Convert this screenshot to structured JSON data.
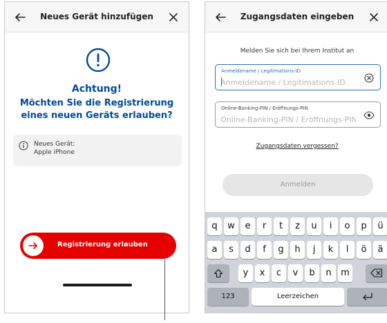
{
  "left_screen": {
    "title": "Neues Gerät hinzufügen",
    "heading": "Achtung!",
    "question": "Möchten Sie die Registrierung eines neuen Geräts erlauben?",
    "device_label": "Neues Gerät:",
    "device_name": "Apple iPhone",
    "allow_button": "Registrierung erlauben"
  },
  "right_screen": {
    "title": "Zugangsdaten eingeben",
    "subtitle": "Melden Sie sich bei Ihrem Institut an",
    "username": {
      "label": "Anmeldename / Legitimations-ID",
      "placeholder": "Anmeldename / Legitimations-ID"
    },
    "pin": {
      "label": "Online-Banking-PIN / Eröffnungs-PIN",
      "placeholder": "Online-Banking-PIN / Eröffnungs-PIN"
    },
    "forgot_link": "Zugangsdaten vergessen?",
    "login_button": "Anmelden"
  },
  "keyboard": {
    "row1": [
      "q",
      "w",
      "e",
      "r",
      "t",
      "z",
      "u",
      "i",
      "o",
      "p",
      "ü"
    ],
    "row2": [
      "a",
      "s",
      "d",
      "f",
      "g",
      "h",
      "j",
      "k",
      "l",
      "ö",
      "ä"
    ],
    "row3": [
      "y",
      "x",
      "c",
      "v",
      "b",
      "n",
      "m"
    ],
    "numbers_key": "123",
    "space_key": "Leerzeichen"
  },
  "colors": {
    "accent_red": "#e60000",
    "heading_blue": "#004a99",
    "field_blue": "#2a6ebd"
  },
  "icons": {
    "back": "arrow-left-icon",
    "close": "close-icon",
    "warning": "exclamation-circle-icon",
    "info": "info-circle-icon",
    "clear": "clear-circle-icon",
    "show_password": "eye-icon",
    "shift": "shift-icon",
    "backspace": "backspace-icon",
    "return": "return-icon"
  }
}
